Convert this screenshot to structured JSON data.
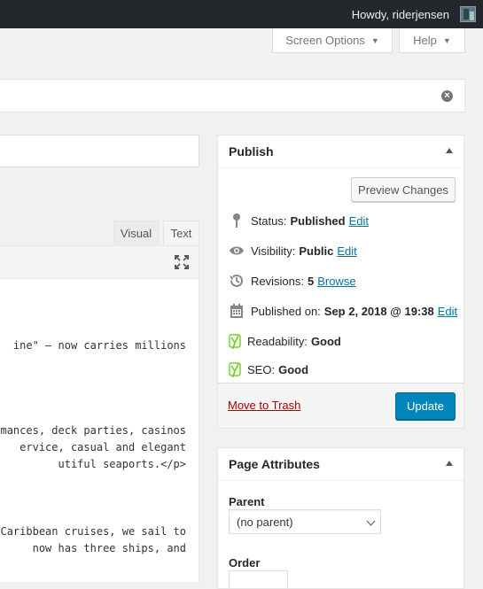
{
  "admin_bar": {
    "greeting": "Howdy, riderjensen"
  },
  "screen_meta": {
    "screen_options": "Screen Options",
    "help": "Help"
  },
  "editor": {
    "tabs": {
      "visual": "Visual",
      "text": "Text"
    },
    "lines": [
      "ine\" — now carries millions",
      "rmances, deck parties, casinos",
      "ervice, casual and elegant",
      "utiful seaports.</p>",
      " Caribbean cruises, we sail to",
      " now has three ships, and"
    ]
  },
  "publish": {
    "title": "Publish",
    "preview_button": "Preview Changes",
    "status_label": "Status:",
    "status_value": "Published",
    "status_edit": "Edit",
    "visibility_label": "Visibility:",
    "visibility_value": "Public",
    "visibility_edit": "Edit",
    "revisions_label": "Revisions:",
    "revisions_value": "5",
    "revisions_link": "Browse",
    "published_label": "Published on:",
    "published_value": "Sep 2, 2018 @ 19:38",
    "published_edit": "Edit",
    "readability_label": "Readability:",
    "readability_value": "Good",
    "seo_label": "SEO:",
    "seo_value": "Good",
    "trash_link": "Move to Trash",
    "update_button": "Update"
  },
  "page_attributes": {
    "title": "Page Attributes",
    "parent_label": "Parent",
    "parent_value": "(no parent)",
    "order_label": "Order"
  },
  "colors": {
    "admin_bar": "#23282d",
    "primary": "#0085ba",
    "link": "#0073aa",
    "trash": "#a00",
    "yoast_good": "#7ad03a"
  },
  "icons": [
    "avatar",
    "dismiss-icon",
    "fullscreen-icon",
    "pin-icon",
    "eye-icon",
    "history-icon",
    "calendar-icon",
    "yoast-icon",
    "toggle-arrow-icon",
    "chevron-down-icon"
  ]
}
